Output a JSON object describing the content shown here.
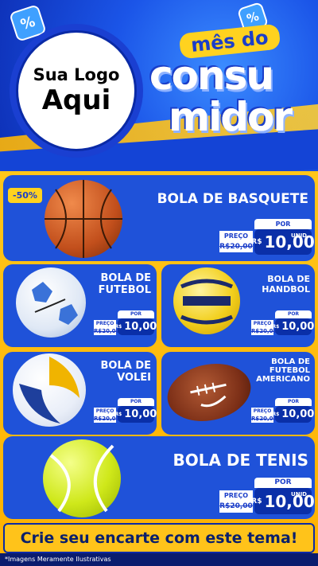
{
  "header": {
    "badge_symbol": "%",
    "logo_line1": "Sua Logo",
    "logo_line2": "Aqui",
    "campaign_mes": "mês do",
    "campaign_w1": "consu",
    "campaign_w2": "midor"
  },
  "featured": {
    "discount": "-50%",
    "title": "BOLA DE BASQUETE",
    "price_label": "POR",
    "preco_label": "PREÇO",
    "old_price": "R$20,00",
    "currency": "R$",
    "new_price": "10,00",
    "unit": "UNID"
  },
  "products": [
    {
      "title": "BOLA DE FUTEBOL",
      "old_price": "R$20,00",
      "new_price": "10,00"
    },
    {
      "title": "BOLA DE HANDBOL",
      "old_price": "R$20,00",
      "new_price": "10,00"
    },
    {
      "title": "BOLA DE VOLEI",
      "old_price": "R$20,00",
      "new_price": "10,00"
    },
    {
      "title": "BOLA DE FUTEBOL AMERICANO",
      "old_price": "R$20,00",
      "new_price": "10,00"
    }
  ],
  "small_price": {
    "por": "POR",
    "preco": "PREÇO",
    "currency": "R$",
    "unit": "UNID"
  },
  "featured2": {
    "title": "BOLA DE TENIS",
    "price_label": "POR",
    "preco_label": "PREÇO",
    "old_price": "R$20,00",
    "currency": "R$",
    "new_price": "10,00",
    "unit": "UNID"
  },
  "cta": "Crie seu encarte com este tema!",
  "footnote": "*Imagens Meramente Ilustrativas",
  "colors": {
    "blue": "#1f52d9",
    "yellow": "#ffc61a",
    "navy": "#0a2fa8"
  }
}
